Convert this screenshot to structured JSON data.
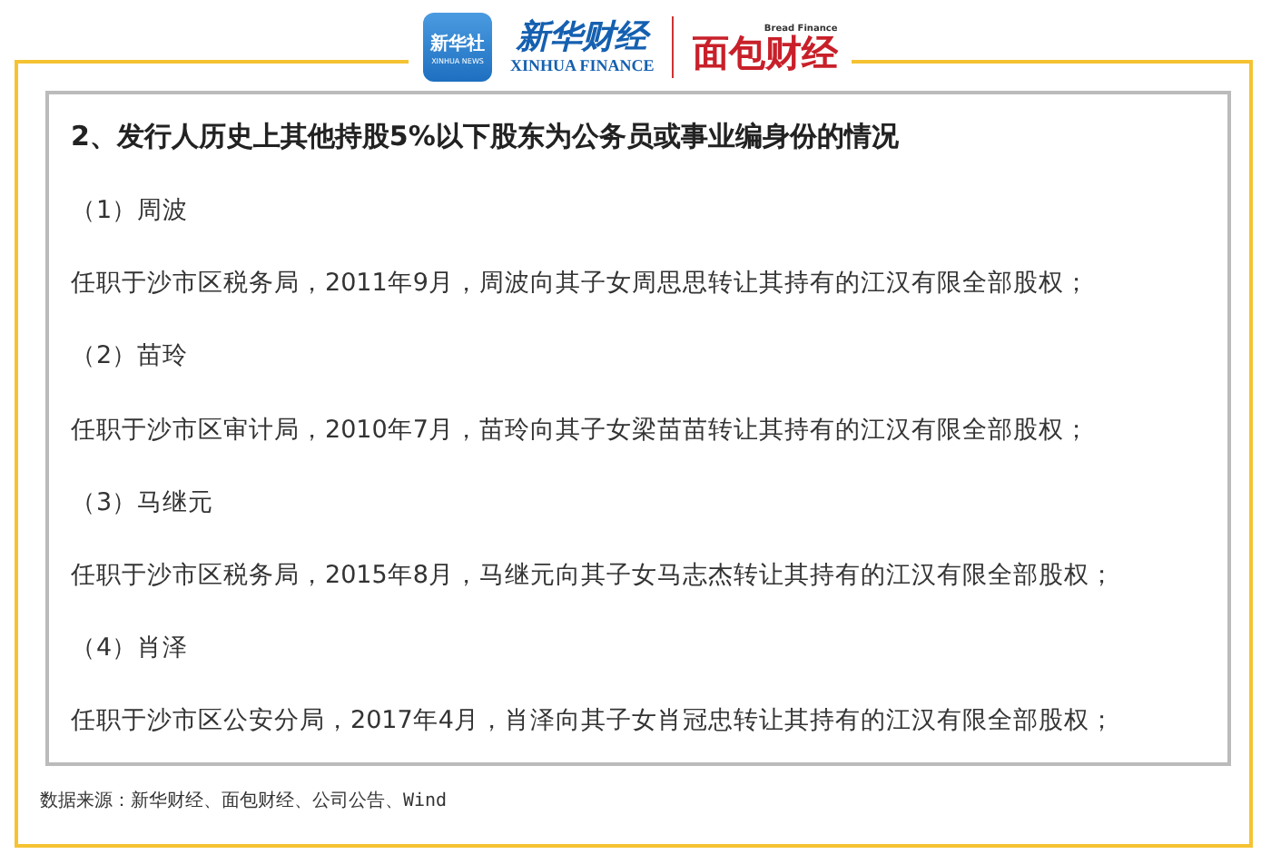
{
  "header": {
    "xinhua_news": {
      "name": "新华社",
      "sub": "XINHUA NEWS"
    },
    "xinhua_finance": {
      "name": "新华财经",
      "sub": "XINHUA FINANCE"
    },
    "bread_finance": {
      "name": "面包财经",
      "sub": "Bread Finance"
    }
  },
  "panel": {
    "title": "2、发行人历史上其他持股5%以下股东为公务员或事业编身份的情况",
    "entries": [
      {
        "name": "（1）周波",
        "detail": "任职于沙市区税务局，2011年9月，周波向其子女周思思转让其持有的江汉有限全部股权；"
      },
      {
        "name": "（2）苗玲",
        "detail": "任职于沙市区审计局，2010年7月，苗玲向其子女梁苗苗转让其持有的江汉有限全部股权；"
      },
      {
        "name": "（3）马继元",
        "detail": "任职于沙市区税务局，2015年8月，马继元向其子女马志杰转让其持有的江汉有限全部股权；"
      },
      {
        "name": "（4）肖泽",
        "detail": "任职于沙市区公安分局，2017年4月，肖泽向其子女肖冠忠转让其持有的江汉有限全部股权；"
      }
    ]
  },
  "source": "数据来源：新华财经、面包财经、公司公告、Wind"
}
